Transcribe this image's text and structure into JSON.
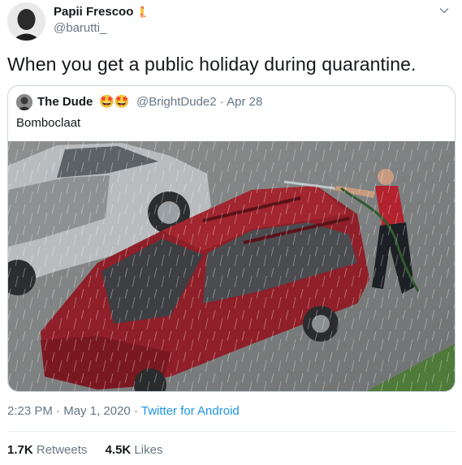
{
  "author": {
    "name": "Papii Frescoo",
    "badge_emoji": "🧜",
    "handle": "@barutti_"
  },
  "tweet": {
    "text": "When you get a public holiday during quarantine."
  },
  "quoted": {
    "name": "The Dude",
    "emojis": "🤩🤩",
    "handle": "@BrightDude2",
    "separator": "·",
    "date": "Apr 28",
    "text": "Bomboclaat",
    "photo_icon": "photo-red-car-rain"
  },
  "meta": {
    "time": "2:23 PM",
    "separator": "·",
    "date": "May 1, 2020",
    "separator2": "·",
    "source": "Twitter for Android"
  },
  "stats": {
    "retweets_count": "1.7K",
    "retweets_label": "Retweets",
    "likes_count": "4.5K",
    "likes_label": "Likes"
  },
  "colors": {
    "link": "#1b95e0",
    "muted": "#657786",
    "border": "#ccd6dd"
  }
}
